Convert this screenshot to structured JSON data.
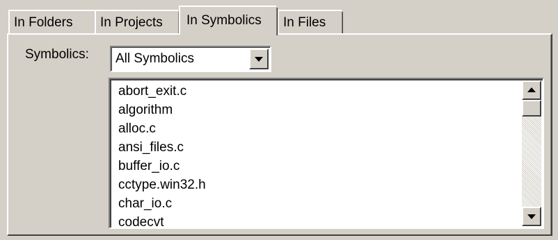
{
  "tabs": [
    {
      "label": "In Folders",
      "active": false
    },
    {
      "label": "In Projects",
      "active": false
    },
    {
      "label": "In Symbolics",
      "active": true
    },
    {
      "label": "In Files",
      "active": false
    }
  ],
  "filter": {
    "label": "Symbolics:",
    "selected": "All Symbolics"
  },
  "files": [
    "abort_exit.c",
    "algorithm",
    "alloc.c",
    "ansi_files.c",
    "buffer_io.c",
    "cctype.win32.h",
    "char_io.c",
    "codecvt"
  ],
  "icons": {
    "combo_button": "chevron-down-icon",
    "scroll_up": "arrow-up-icon",
    "scroll_down": "arrow-down-icon"
  },
  "colors": {
    "face": "#d4d0c8",
    "highlight": "#ffffff",
    "shadow": "#808080",
    "dark_shadow": "#404040",
    "window": "#ffffff",
    "text": "#000000"
  }
}
